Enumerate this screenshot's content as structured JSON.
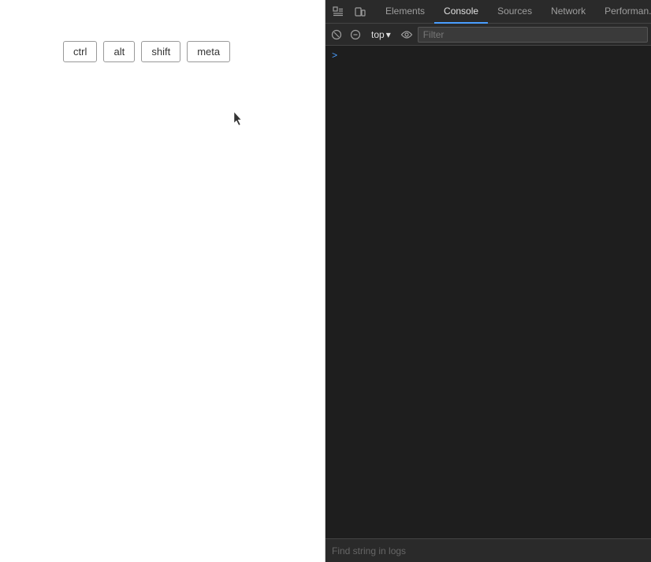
{
  "left_panel": {
    "key_buttons": [
      {
        "label": "ctrl",
        "id": "ctrl"
      },
      {
        "label": "alt",
        "id": "alt"
      },
      {
        "label": "shift",
        "id": "shift"
      },
      {
        "label": "meta",
        "id": "meta"
      }
    ]
  },
  "devtools": {
    "tabs": [
      {
        "label": "Elements",
        "active": false
      },
      {
        "label": "Console",
        "active": true
      },
      {
        "label": "Sources",
        "active": false
      },
      {
        "label": "Network",
        "active": false
      },
      {
        "label": "Performan...",
        "active": false
      }
    ],
    "toolbar": {
      "top_label": "top",
      "filter_placeholder": "Filter"
    },
    "console_prompt": ">",
    "find_bar_placeholder": "Find string in logs"
  }
}
